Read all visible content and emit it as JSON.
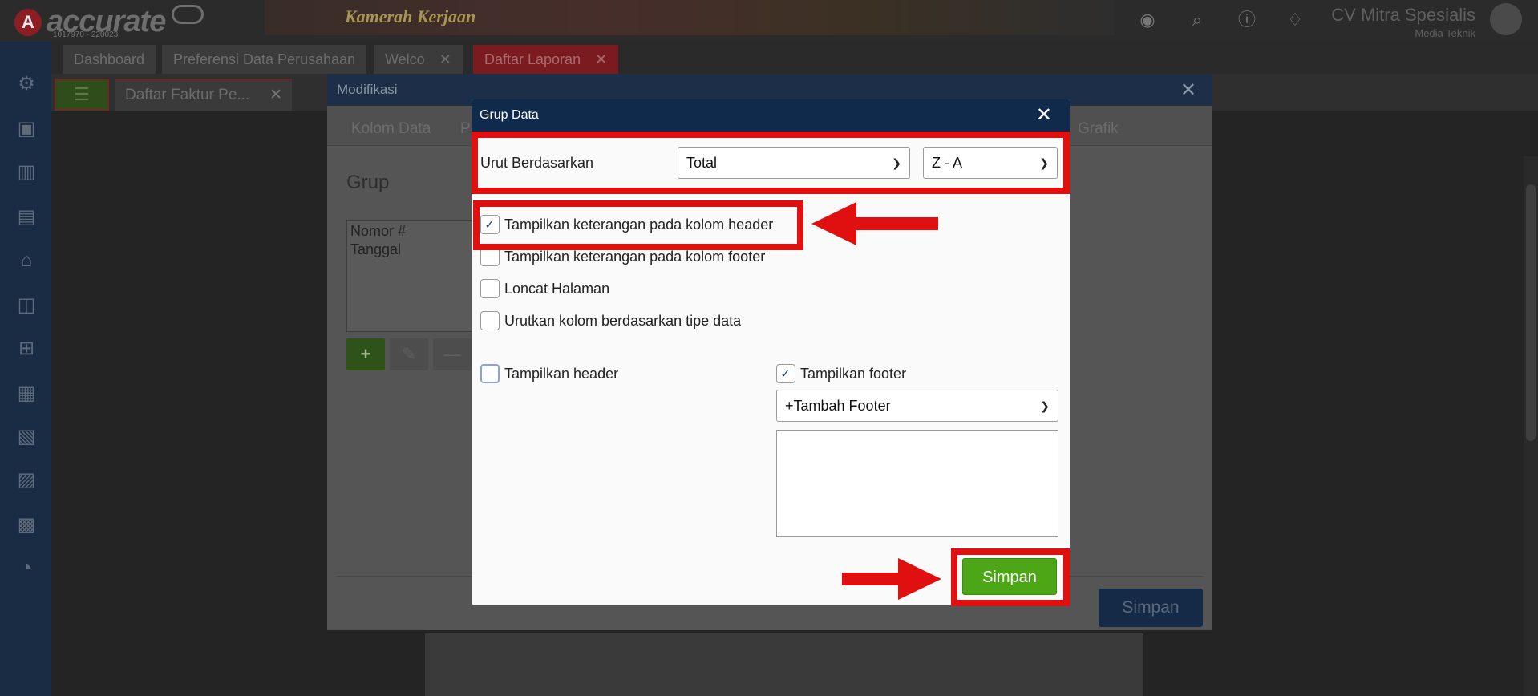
{
  "app": {
    "brand": "accurate",
    "license": "1017970 - 220023",
    "banner_text": "Kamerah Kerjaan",
    "company_name": "CV Mitra Spesialis",
    "user_name": "Media Teknik"
  },
  "tabs": [
    {
      "label": "Dashboard"
    },
    {
      "label": "Preferensi Data Perusahaan"
    },
    {
      "label": "Welco"
    },
    {
      "label": "Daftar Laporan"
    }
  ],
  "doc_tab": {
    "label": "Daftar Faktur Pe..."
  },
  "modifikasi": {
    "title": "Modifikasi",
    "tabs": [
      "Kolom Data",
      "P",
      "Grafik"
    ],
    "section_title": "Grup",
    "group_items": [
      "Nomor #",
      "Tanggal"
    ],
    "save_label": "Simpan"
  },
  "grup_data": {
    "title": "Grup Data",
    "sort_label": "Urut Berdasarkan",
    "sort_field": "Total",
    "sort_order": "Z - A",
    "options": [
      {
        "label": "Tampilkan keterangan pada kolom header",
        "checked": true
      },
      {
        "label": "Tampilkan keterangan pada kolom footer",
        "checked": false
      },
      {
        "label": "Loncat Halaman",
        "checked": false
      },
      {
        "label": "Urutkan kolom berdasarkan tipe data",
        "checked": false
      }
    ],
    "show_header_label": "Tampilkan header",
    "show_header_checked": false,
    "show_footer_label": "Tampilkan footer",
    "show_footer_checked": true,
    "add_footer_label": "+Tambah Footer",
    "save_label": "Simpan"
  },
  "colors": {
    "highlight": "#e11010",
    "save_green": "#4ca615",
    "dialog_header": "#102a4c"
  }
}
